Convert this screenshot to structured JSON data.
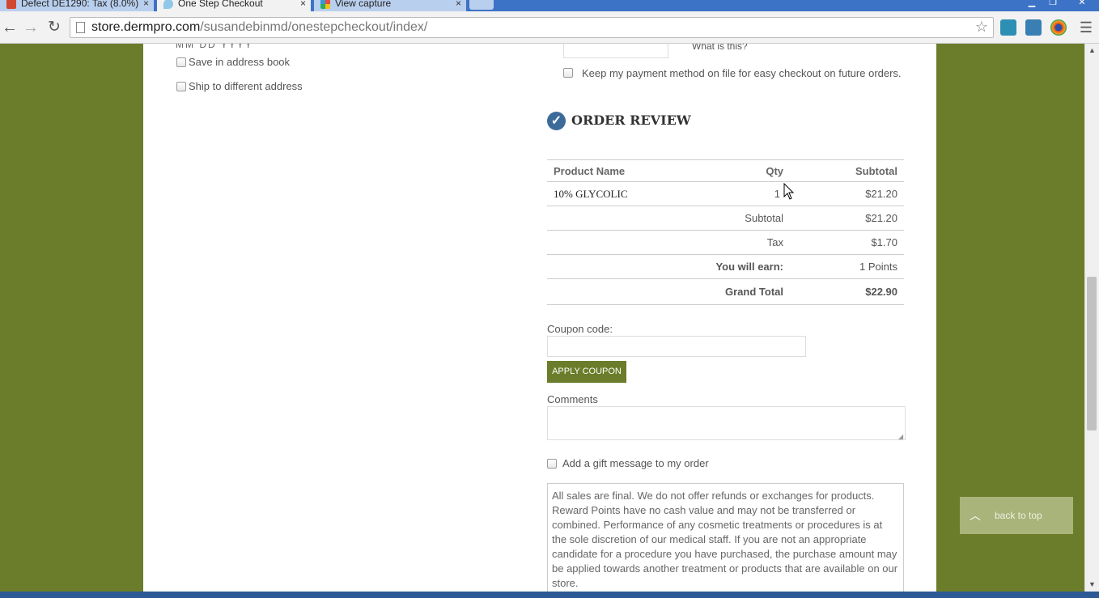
{
  "browser": {
    "tabs": [
      {
        "label": "Defect DE1290: Tax (8.0%)",
        "state": "inactive",
        "icon": "rally-favicon"
      },
      {
        "label": "One Step Checkout",
        "state": "active",
        "icon": "droplet-favicon"
      },
      {
        "label": "View capture",
        "state": "inactive",
        "icon": "capture-favicon"
      }
    ],
    "close_glyph": "×",
    "url_host": "store.dermpro.com",
    "url_path": "/susandebinmd/onestepcheckout/index/"
  },
  "billing": {
    "cut_text": "MM   DD   YYYY",
    "save_address_label": "Save in address book",
    "ship_different_label": "Ship to different address"
  },
  "payment": {
    "what_is_this": "What is this?",
    "keep_on_file_label": "Keep my payment method on file for easy checkout on future orders."
  },
  "review": {
    "title": "ORDER REVIEW",
    "headers": {
      "product": "Product Name",
      "qty": "Qty",
      "subtotal": "Subtotal"
    },
    "items": [
      {
        "name": "10% GLYCOLIC",
        "qty": "1",
        "subtotal": "$21.20"
      }
    ],
    "totals": {
      "subtotal_label": "Subtotal",
      "subtotal_value": "$21.20",
      "tax_label": "Tax",
      "tax_value": "$1.70",
      "earn_label": "You will earn:",
      "earn_value": "1 Points",
      "grand_label": "Grand Total",
      "grand_value": "$22.90"
    }
  },
  "coupon": {
    "label": "Coupon code:",
    "value": "",
    "button": "APPLY COUPON"
  },
  "comments": {
    "label": "Comments",
    "value": ""
  },
  "gift": {
    "label": "Add a gift message to my order"
  },
  "terms": {
    "text": "All sales are final. We do not offer refunds or exchanges for products. Reward Points have no cash value and may not be transferred or combined. Performance of any cosmetic treatments or procedures is at the sole discretion of our medical staff. If you are not an appropriate candidate for a procedure you have purchased, the purchase amount may be applied towards another treatment or products that are available on our store."
  },
  "back_to_top": {
    "label": "back to top"
  },
  "colors": {
    "brand_green": "#6b7d2a",
    "check_blue": "#3d6b99"
  }
}
